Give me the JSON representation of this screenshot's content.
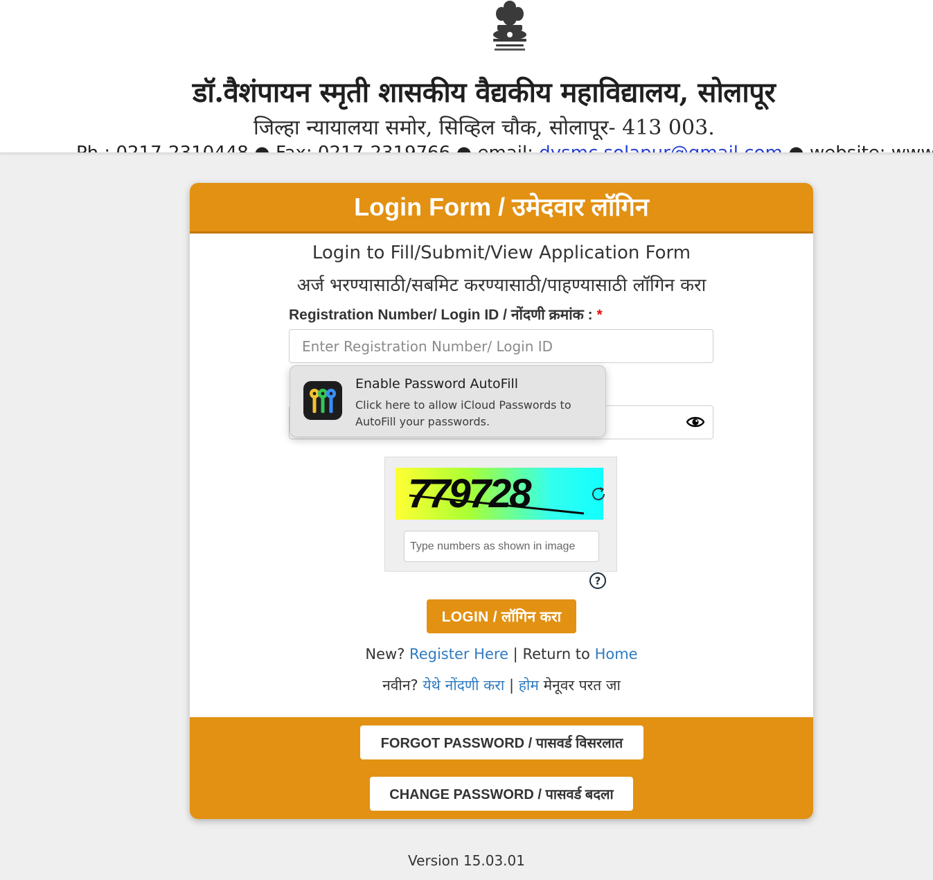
{
  "header": {
    "emblem_icon": "state-emblem-icon",
    "institution_name": "डॉ.वैशंपायन स्मृती शासकीय वैद्यकीय महाविद्यालय, सोलापूर",
    "address": "जिल्हा न्यायालया समोर, सिव्हिल चौक, सोलापूर- 413 003.",
    "contact_prefix": "Ph.: 0217-2310448 ● Fax: 0217-2319766 ● email: ",
    "contact_email": "dvsmc.solapur@gmail.com",
    "contact_suffix": " ● website: www.gmcsolapur.org"
  },
  "form": {
    "title": "Login Form / उमेदवार लॉगिन",
    "subtitle_en": "Login to Fill/Submit/View Application Form",
    "subtitle_mr": "अर्ज भरण्यासाठी/सबमिट करण्यासाठी/पाहण्यासाठी लॉगिन करा",
    "login_label": "Registration Number/ Login ID / नोंदणी क्रमांक : ",
    "required_marker": "*",
    "login_placeholder": "Enter Registration Number/ Login ID",
    "login_value": "",
    "password_value": "",
    "password_toggle_icon": "eye-icon",
    "captcha": {
      "image_text": "779728",
      "refresh_icon": "refresh-icon",
      "input_placeholder": "Type numbers as shown in image",
      "input_value": "",
      "help_icon": "question-circle-icon",
      "gradient_colors": [
        "#ffff33",
        "#aaff33",
        "#33ffee",
        "#11ffff"
      ]
    },
    "login_button": "LOGIN / लॉगिन करा",
    "links_en": {
      "new_prefix": "New? ",
      "register": "Register Here",
      "separator": " | ",
      "return_prefix": "Return to ",
      "home": "Home"
    },
    "links_mr": {
      "new_prefix": "नवीन? ",
      "register": "येथे नोंदणी करा",
      "separator": " | ",
      "home": "होम",
      "return_suffix": " मेनूवर परत जा"
    },
    "forgot_button": "FORGOT PASSWORD / पासवर्ड विसरलात",
    "change_button": "CHANGE PASSWORD / पासवर्ड बदला"
  },
  "autofill": {
    "icon": "passwords-keys-icon",
    "title": "Enable Password AutoFill",
    "description": "Click here to allow iCloud Passwords to AutoFill your passwords."
  },
  "version": "Version 15.03.01",
  "colors": {
    "accent": "#e29113",
    "link": "#2f7bbf",
    "required": "#e01010",
    "page_background": "#efefef"
  }
}
